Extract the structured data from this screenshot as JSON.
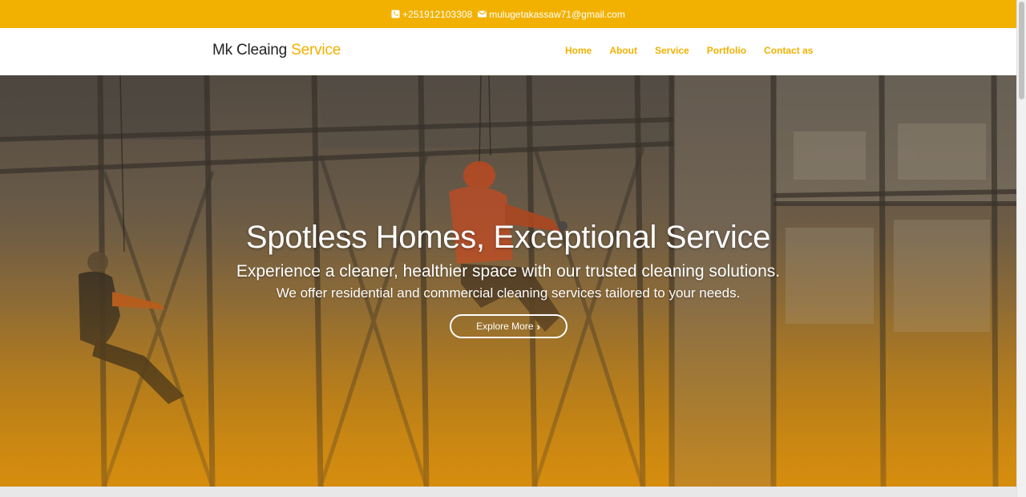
{
  "topbar": {
    "phone": "+251912103308",
    "email": "mulugetakassaw71@gmail.com",
    "phone_icon": "phone-icon",
    "email_icon": "envelope-icon",
    "background": "#f2b100"
  },
  "navbar": {
    "brand_main": "Mk Cleaing",
    "brand_accent": "Service",
    "links": [
      "Home",
      "About",
      "Service",
      "Portfolio",
      "Contact as"
    ],
    "accent_color": "#f2b100"
  },
  "hero": {
    "title": "Spotless Homes, Exceptional Service",
    "subtitle": "Experience a cleaner, healthier space with our trusted cleaning solutions.",
    "description": "We offer residential and commercial cleaning services tailored to your needs.",
    "cta_label": "Explore More",
    "cta_icon": "chevron-right-icon"
  }
}
